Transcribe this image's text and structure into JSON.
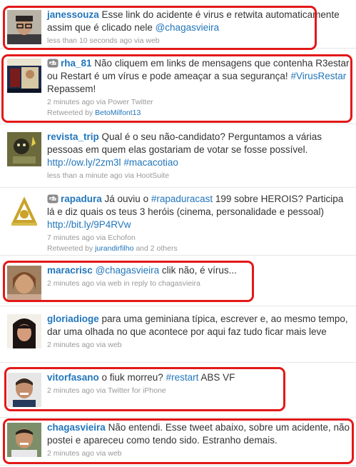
{
  "tweets": [
    {
      "username": "janessouza",
      "parts": [
        {
          "t": " Esse link do acidente é virus e retwita automaticamente assim que é clicado nele "
        },
        {
          "t": "@chagasvieira",
          "k": "mention"
        }
      ],
      "time": "less than 10 seconds ago",
      "via": "via",
      "source": "web",
      "retweet_icon": false
    },
    {
      "username": "rha_81",
      "parts": [
        {
          "t": " Não cliquem em links de mensagens que contenha R3estar ou Restart é um vírus e pode ameaçar a sua segurança! "
        },
        {
          "t": "#VirusRestar",
          "k": "hashtag"
        },
        {
          "t": " Repassem!"
        }
      ],
      "time": "2 minutes ago",
      "via": "via",
      "source": "Power Twitter",
      "retweet_icon": true,
      "retweeted_by_label": "Retweeted by",
      "retweeted_by": "BetoMilfont13",
      "retweeted_extra": ""
    },
    {
      "username": "revista_trip",
      "parts": [
        {
          "t": " Qual é o seu não-candidato? Perguntamos a várias pessoas em quem elas gostariam de votar se fosse possível. "
        },
        {
          "t": "http://ow.ly/2zm3l",
          "k": "link"
        },
        {
          "t": " "
        },
        {
          "t": "#macacotiao",
          "k": "hashtag"
        }
      ],
      "time": "less than a minute ago",
      "via": "via",
      "source": "HootSuite",
      "retweet_icon": false
    },
    {
      "username": "rapadura",
      "parts": [
        {
          "t": " Já ouviu o "
        },
        {
          "t": "#rapaduracast",
          "k": "hashtag"
        },
        {
          "t": " 199 sobre HEROIS? Participa lá e diz quais os teus 3 heróis (cinema, personalidade e pessoal) "
        },
        {
          "t": "http://bit.ly/9P4RVw",
          "k": "link"
        }
      ],
      "time": "7 minutes ago",
      "via": "via",
      "source": "Echofon",
      "retweet_icon": true,
      "retweeted_by_label": "Retweeted by",
      "retweeted_by": "jurandirfilho",
      "retweeted_extra": "and 2 others"
    },
    {
      "username": "maracrisc",
      "parts": [
        {
          "t": " "
        },
        {
          "t": "@chagasvieira",
          "k": "mention"
        },
        {
          "t": " clik não, é vírus..."
        }
      ],
      "time": "2 minutes ago",
      "via": "via",
      "source": "web",
      "reply_label": "in reply to",
      "reply_to": "chagasvieira",
      "retweet_icon": false
    },
    {
      "username": "gloriadioge",
      "parts": [
        {
          "t": " para uma geminiana típica, escrever e, ao mesmo tempo, dar uma olhada no que acontece por aqui faz tudo ficar mais leve"
        }
      ],
      "time": "2 minutes ago",
      "via": "via",
      "source": "web",
      "retweet_icon": false
    },
    {
      "username": "vitorfasano",
      "parts": [
        {
          "t": " o fiuk morreu? "
        },
        {
          "t": "#restart",
          "k": "hashtag"
        },
        {
          "t": " ABS VF"
        }
      ],
      "time": "2 minutes ago",
      "via": "via",
      "source": "Twitter for iPhone",
      "retweet_icon": false
    },
    {
      "username": "chagasvieira",
      "parts": [
        {
          "t": " Não entendi. Esse tweet abaixo, sobre um acidente, não postei e apareceu como tendo sido. Estranho demais."
        }
      ],
      "time": "2 minutes ago",
      "via": "via",
      "source": "web",
      "retweet_icon": false
    }
  ],
  "colors": {
    "link": "#2276bb",
    "text": "#333333",
    "meta": "#999999",
    "highlight": "#e31818",
    "divider": "#e6e6e6"
  },
  "icons": {
    "retweet": "retweet-icon"
  }
}
